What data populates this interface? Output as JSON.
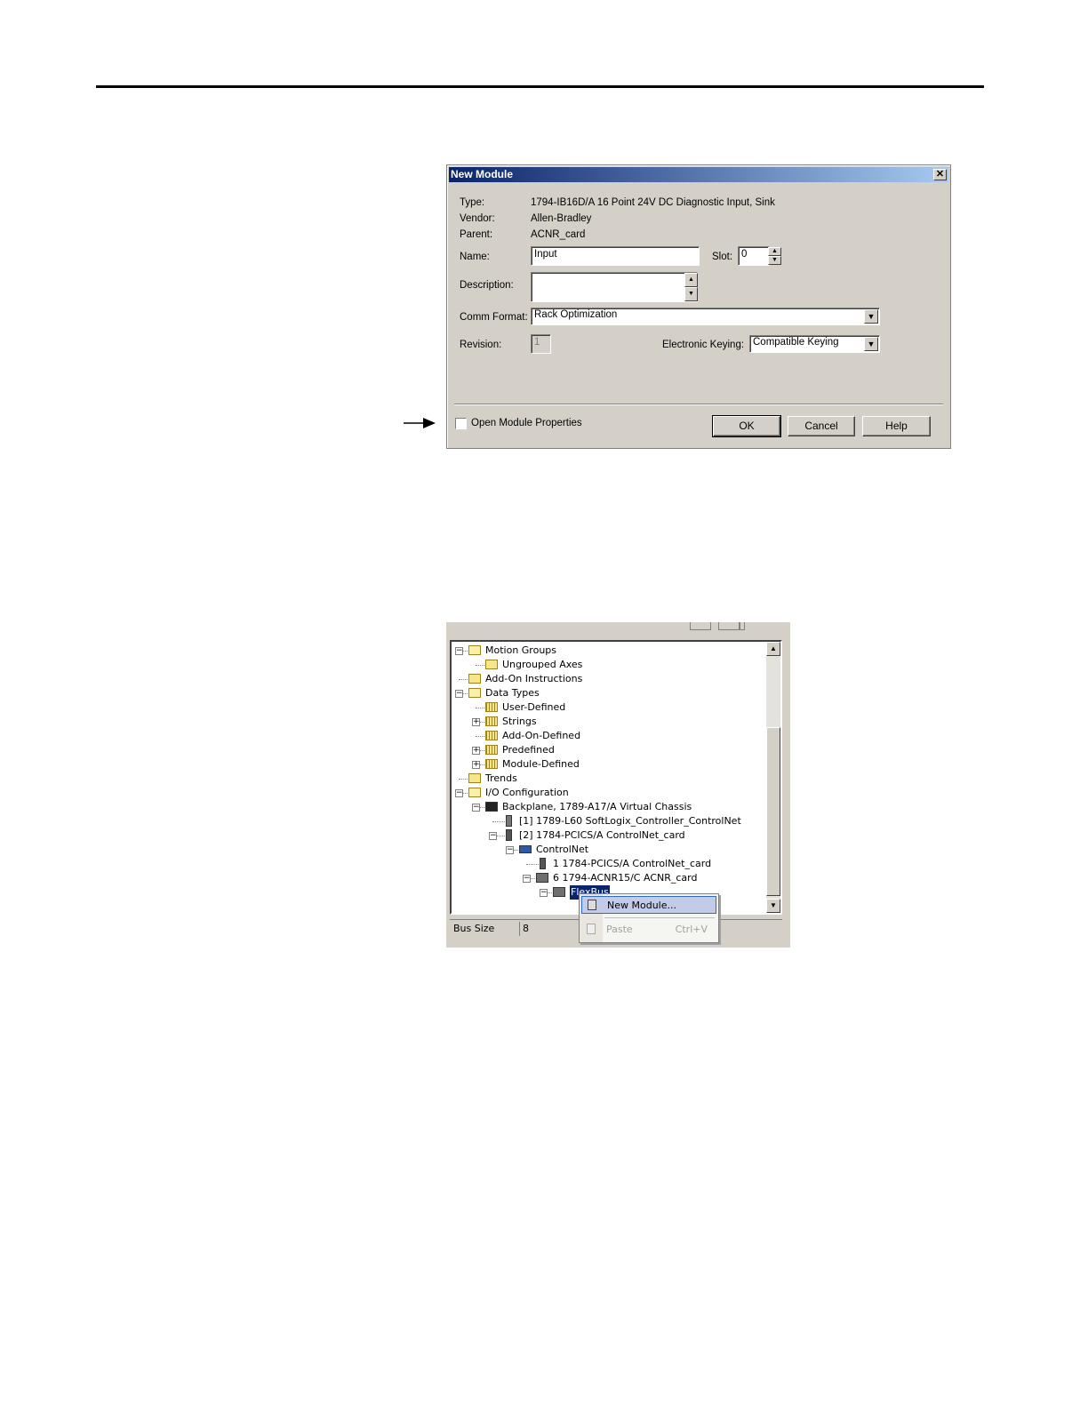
{
  "dialog": {
    "title": "New Module",
    "close": "✕",
    "type_label": "Type:",
    "type_value": "1794-IB16D/A 16 Point 24V DC Diagnostic Input, Sink",
    "vendor_label": "Vendor:",
    "vendor_value": "Allen-Bradley",
    "parent_label": "Parent:",
    "parent_value": "ACNR_card",
    "name_label": "Name:",
    "name_value": "Input",
    "slot_label": "Slot:",
    "slot_value": "0",
    "description_label": "Description:",
    "description_value": "",
    "comm_format_label": "Comm Format:",
    "comm_format_value": "Rack Optimization",
    "revision_label": "Revision:",
    "revision_value": "1",
    "keying_label": "Electronic Keying:",
    "keying_value": "Compatible Keying",
    "open_props_label": "Open Module Properties",
    "open_props_checked": false,
    "ok_label": "OK",
    "cancel_label": "Cancel",
    "help_label": "Help"
  },
  "tree": {
    "nodes": [
      {
        "label": "Motion Groups",
        "icon": "folder-open-icon",
        "expander": "−"
      },
      {
        "label": "Ungrouped Axes",
        "icon": "folder-icon"
      },
      {
        "label": "Add-On Instructions",
        "icon": "folder-icon"
      },
      {
        "label": "Data Types",
        "icon": "folder-open-icon",
        "expander": "−"
      },
      {
        "label": "User-Defined",
        "icon": "datatype-folder-icon"
      },
      {
        "label": "Strings",
        "icon": "datatype-folder-icon",
        "expander": "+"
      },
      {
        "label": "Add-On-Defined",
        "icon": "datatype-folder-icon"
      },
      {
        "label": "Predefined",
        "icon": "datatype-folder-icon",
        "expander": "+"
      },
      {
        "label": "Module-Defined",
        "icon": "datatype-folder-icon",
        "expander": "+"
      },
      {
        "label": "Trends",
        "icon": "folder-icon"
      },
      {
        "label": "I/O Configuration",
        "icon": "folder-open-icon",
        "expander": "−"
      },
      {
        "label": "Backplane, 1789-A17/A Virtual Chassis",
        "icon": "backplane-icon",
        "expander": "−"
      },
      {
        "label": "[1] 1789-L60 SoftLogix_Controller_ControlNet",
        "icon": "controller-icon"
      },
      {
        "label": "[2] 1784-PCICS/A ControlNet_card",
        "icon": "module-icon",
        "expander": "−"
      },
      {
        "label": "ControlNet",
        "icon": "network-icon",
        "expander": "−"
      },
      {
        "label": "1 1784-PCICS/A ControlNet_card",
        "icon": "module-icon"
      },
      {
        "label": "6 1794-ACNR15/C ACNR_card",
        "icon": "adapter-icon",
        "expander": "−"
      },
      {
        "label": "FlexBus",
        "icon": "bus-icon",
        "expander": "−",
        "selected": true
      }
    ]
  },
  "status": {
    "name": "Bus Size",
    "value": "8"
  },
  "context_menu": {
    "new_module": "New Module...",
    "paste": "Paste",
    "paste_shortcut": "Ctrl+V"
  }
}
